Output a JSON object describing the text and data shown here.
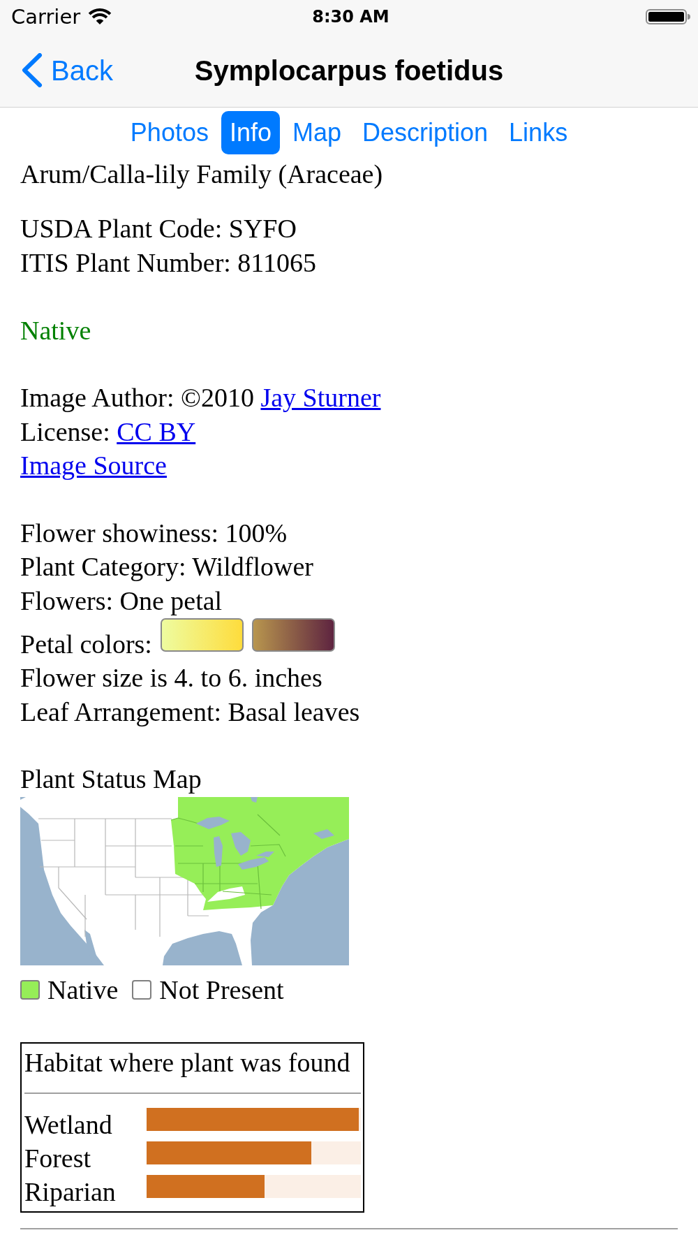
{
  "status_bar": {
    "carrier": "Carrier",
    "time": "8:30 AM"
  },
  "nav": {
    "back": "Back",
    "title": "Symplocarpus foetidus"
  },
  "tabs": [
    {
      "label": "Photos",
      "selected": false
    },
    {
      "label": "Info",
      "selected": true
    },
    {
      "label": "Map",
      "selected": false
    },
    {
      "label": "Description",
      "selected": false
    },
    {
      "label": "Links",
      "selected": false
    }
  ],
  "family": "Arum/Calla-lily Family (Araceae)",
  "codes": [
    "USDA Plant Code: SYFO",
    "ITIS Plant Number: 811065"
  ],
  "native_status": "Native",
  "credits": [
    {
      "kind": "attributed",
      "label": "Image Author: ©2010",
      "link": "Jay Sturner"
    },
    {
      "kind": "attributed",
      "label": "License:",
      "link": "CC BY"
    },
    {
      "kind": "link",
      "link": "Image Source"
    }
  ],
  "facts": [
    {
      "kind": "text",
      "text": "Flower showiness: 100%"
    },
    {
      "kind": "text",
      "text": "Plant Category: Wildflower"
    },
    {
      "kind": "text",
      "text": "Flowers: One petal"
    },
    {
      "kind": "colors",
      "text": "Petal colors:",
      "swatches": [
        {
          "stops": [
            {
              "color": "#eefca0"
            },
            {
              "color": "#fedc3c"
            }
          ]
        },
        {
          "stops": [
            {
              "color": "#b8964e"
            },
            {
              "color": "#5e2440"
            }
          ]
        }
      ]
    },
    {
      "kind": "text",
      "text": "Flower size is 4. to 6. inches"
    },
    {
      "kind": "text",
      "text": "Leaf Arrangement: Basal leaves"
    }
  ],
  "status_map": {
    "title": "Plant Status Map",
    "legend": [
      {
        "label": "Native",
        "color": "#96ee58"
      },
      {
        "label": "Not Present",
        "color": "#ffffff"
      }
    ]
  },
  "habitat": {
    "title": "Habitat where plant was found",
    "rows": [
      {
        "label": "Wetland",
        "level": 0.99
      },
      {
        "label": "Forest",
        "level": 0.77
      },
      {
        "label": "Riparian",
        "level": 0.55
      }
    ]
  }
}
